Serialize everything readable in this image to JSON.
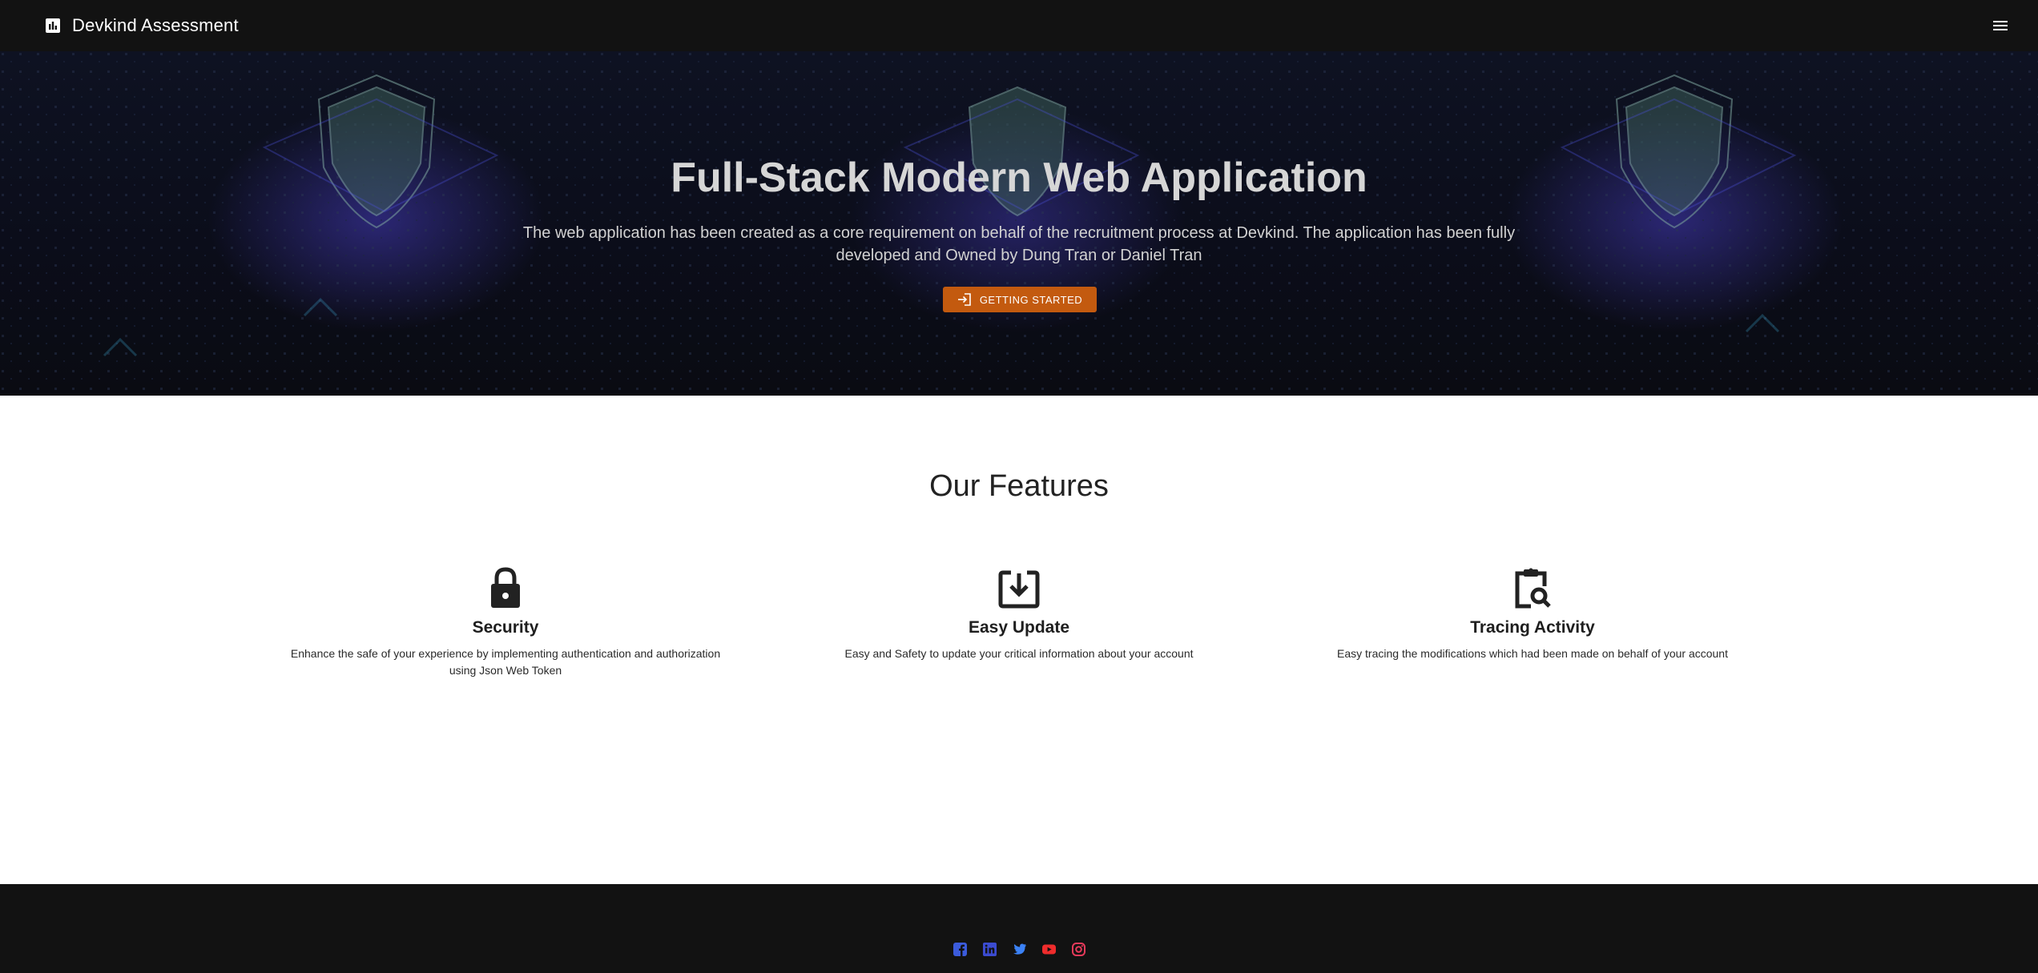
{
  "appbar": {
    "title": "Devkind Assessment",
    "brand_icon": "bar-chart-icon",
    "menu_icon": "hamburger-menu-icon"
  },
  "hero": {
    "title": "Full-Stack Modern Web Application",
    "description": "The web application has been created as a core requirement on behalf of the recruitment process at Devkind. The application has been fully developed and Owned by Dung Tran or Daniel Tran",
    "cta_label": "GETTING STARTED",
    "cta_icon": "login-icon",
    "cta_color": "#c35a0f"
  },
  "features": {
    "title": "Our Features",
    "items": [
      {
        "icon": "lock-icon",
        "title": "Security",
        "description": "Enhance the safe of your experience by implementing authentication and authorization using Json Web Token"
      },
      {
        "icon": "download-box-icon",
        "title": "Easy Update",
        "description": "Easy and Safety to update your critical information about your account"
      },
      {
        "icon": "clipboard-search-icon",
        "title": "Tracing Activity",
        "description": "Easy tracing the modifications which had been made on behalf of your account"
      }
    ]
  },
  "footer": {
    "socials": [
      {
        "icon": "facebook-icon",
        "color": "#3b5bdb"
      },
      {
        "icon": "linkedin-icon",
        "color": "#3b4bd0"
      },
      {
        "icon": "twitter-icon",
        "color": "#3b82f6"
      },
      {
        "icon": "youtube-icon",
        "color": "#ef2c2c"
      },
      {
        "icon": "instagram-icon",
        "color": "#e63a5a"
      }
    ]
  },
  "colors": {
    "appbar_bg": "#121212",
    "footer_bg": "#121212",
    "accent": "#c35a0f"
  }
}
